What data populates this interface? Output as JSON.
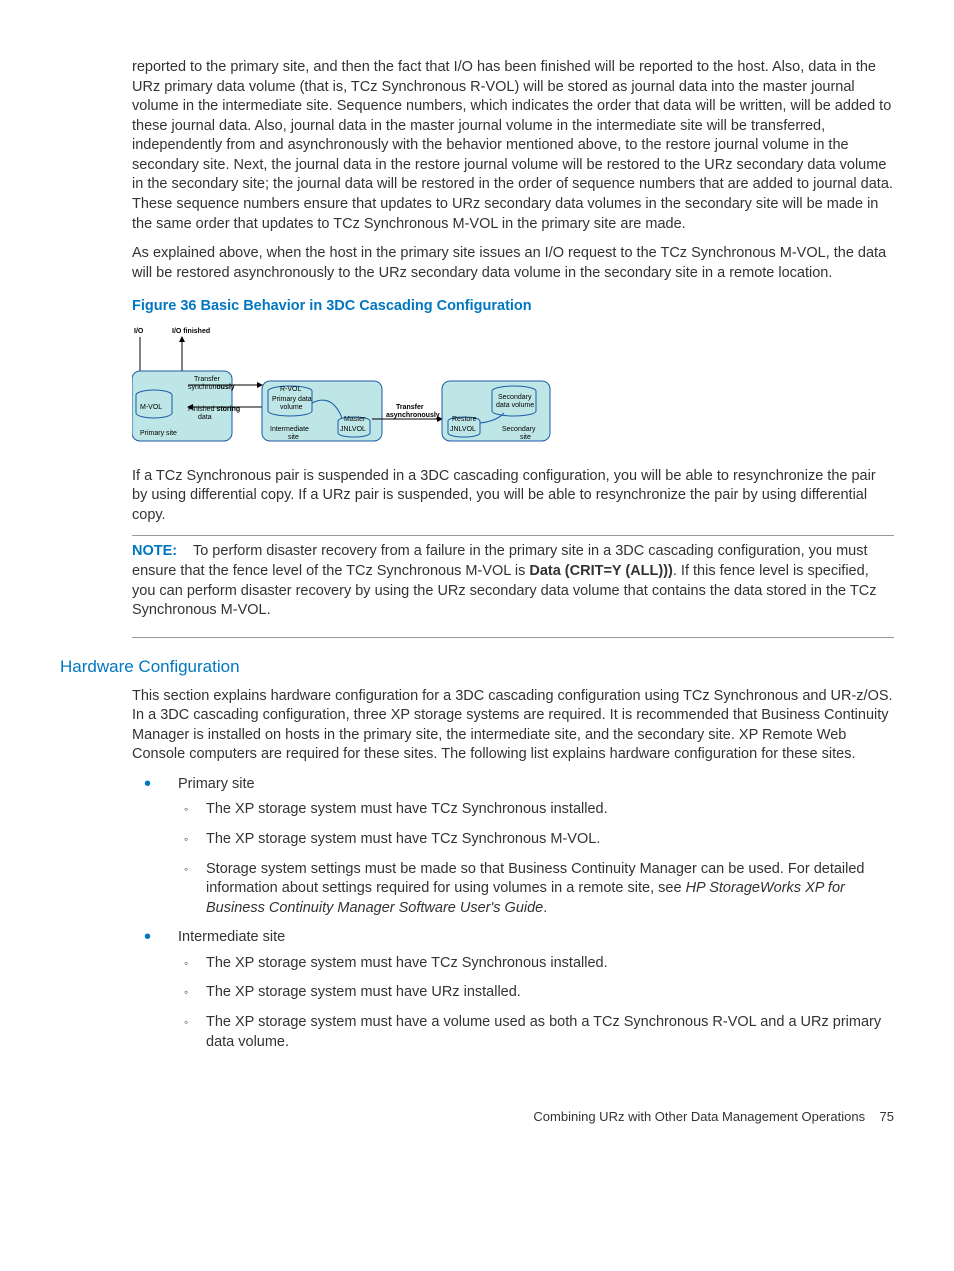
{
  "para1": "reported to the primary site, and then the fact that I/O has been finished will be reported to the host. Also, data in the URz primary data volume (that is, TCz Synchronous R-VOL) will be stored as journal data into the master journal volume in the intermediate site. Sequence numbers, which indicates the order that data will be written, will be added to these journal data. Also, journal data in the master journal volume in the intermediate site will be transferred, independently from and asynchronously with the behavior mentioned above, to the restore journal volume in the secondary site. Next, the journal data in the restore journal volume will be restored to the URz secondary data volume in the secondary site; the journal data will be restored in the order of sequence numbers that are added to journal data. These sequence numbers ensure that updates to URz secondary data volumes in the secondary site will be made in the same order that updates to TCz Synchronous M-VOL in the primary site are made.",
  "para2": "As explained above, when the host in the primary site issues an I/O request to the TCz Synchronous M-VOL, the data will be restored asynchronously to the URz secondary data volume in the secondary site in a remote location.",
  "figcaption": "Figure 36 Basic Behavior in 3DC Cascading Configuration",
  "diagram": {
    "io": "I/O",
    "iof": "I/O finished",
    "ts": "Transfer",
    "sync": "synchron",
    "ously": "ously",
    "fin": "Finished",
    "stor": "storing",
    "data": "data",
    "mvol": "M-VOL",
    "psite": "Primary site",
    "rvol": "R-VOL",
    "pdv": "Primary data",
    "vol": "volume",
    "isite": "Intermediate",
    "site": "site",
    "mjnl": "Master",
    "jnlvol": "JNLVOL",
    "tasync": "Transfer",
    "async": "asynchronously",
    "rjnl": "Restore",
    "sdv": "Secondary",
    "dv": "data volume",
    "ssite": "Secondar",
    "y": "y"
  },
  "para3": "If a TCz Synchronous pair is suspended in a 3DC cascading configuration, you will be able to resynchronize the pair by using differential copy. If a URz pair is suspended, you will be able to resynchronize the pair by using differential copy.",
  "note": {
    "label": "NOTE:",
    "t1": "To perform disaster recovery from a failure in the primary site in a 3DC cascading configuration, you must ensure that the fence level of the TCz Synchronous M-VOL is ",
    "b": "Data (CRIT=Y (ALL)))",
    "t2": ". If this fence level is specified, you can perform disaster recovery by using the URz secondary data volume that contains the data stored in the TCz Synchronous M-VOL."
  },
  "h2": "Hardware Configuration",
  "para4": "This section explains hardware configuration for a 3DC cascading configuration using TCz Synchronous and UR-z/OS. In a 3DC cascading configuration, three XP storage systems are required. It is recommended that Business Continuity Manager is installed on hosts in the primary site, the intermediate site, and the secondary site. XP Remote Web Console computers are required for these sites. The following list explains hardware configuration for these sites.",
  "list": {
    "li1": "Primary site",
    "li1a": "The XP storage system must have TCz Synchronous installed.",
    "li1b": "The XP storage system must have TCz Synchronous M-VOL.",
    "li1c": "Storage system settings must be made so that Business Continuity Manager can be used. For detailed information about settings required for using volumes in a remote site, see ",
    "li1c_i": "HP StorageWorks XP for Business Continuity Manager Software User's Guide",
    "li2": "Intermediate site",
    "li2a": "The XP storage system must have TCz Synchronous installed.",
    "li2b": "The XP storage system must have URz installed.",
    "li2c": "The XP storage system must have a volume used as both a TCz Synchronous R-VOL and a URz primary data volume."
  },
  "footer": {
    "title": "Combining URz with Other Data Management Operations",
    "page": "75"
  }
}
